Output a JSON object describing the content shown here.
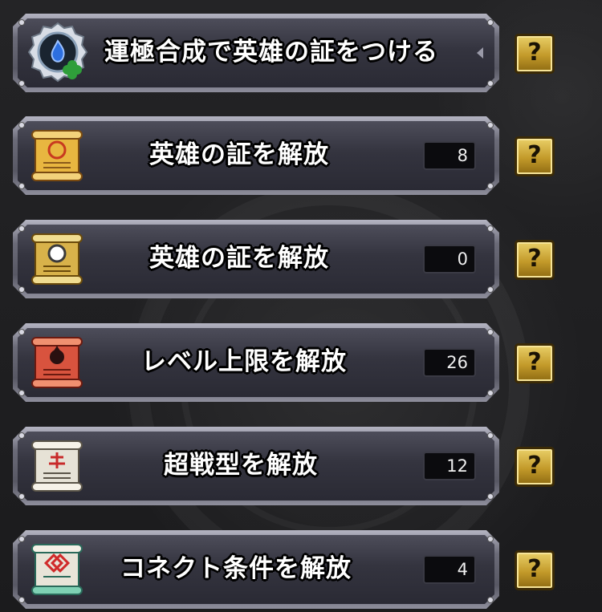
{
  "rows": [
    {
      "label": "運極合成で英雄の証をつける",
      "count": null,
      "icon": "hero-badge-icon",
      "help": "?"
    },
    {
      "label": "英雄の証を解放",
      "count": "8",
      "icon": "gold-scroll-icon",
      "help": "?"
    },
    {
      "label": "英雄の証を解放",
      "count": "0",
      "icon": "platinum-scroll-icon",
      "help": "?"
    },
    {
      "label": "レベル上限を解放",
      "count": "26",
      "icon": "red-scroll-icon",
      "help": "?"
    },
    {
      "label": "超戦型を解放",
      "count": "12",
      "icon": "white-scroll-icon",
      "help": "?"
    },
    {
      "label": "コネクト条件を解放",
      "count": "4",
      "icon": "teal-scroll-icon",
      "help": "?"
    }
  ],
  "colors": {
    "gold_scroll": "#e8b640",
    "platinum_scroll": "#d8b24a",
    "red_scroll": "#d8533e",
    "white_scroll": "#e6e2d6",
    "teal_scroll": "#7fd1b4",
    "help_button": "#c9a136"
  }
}
